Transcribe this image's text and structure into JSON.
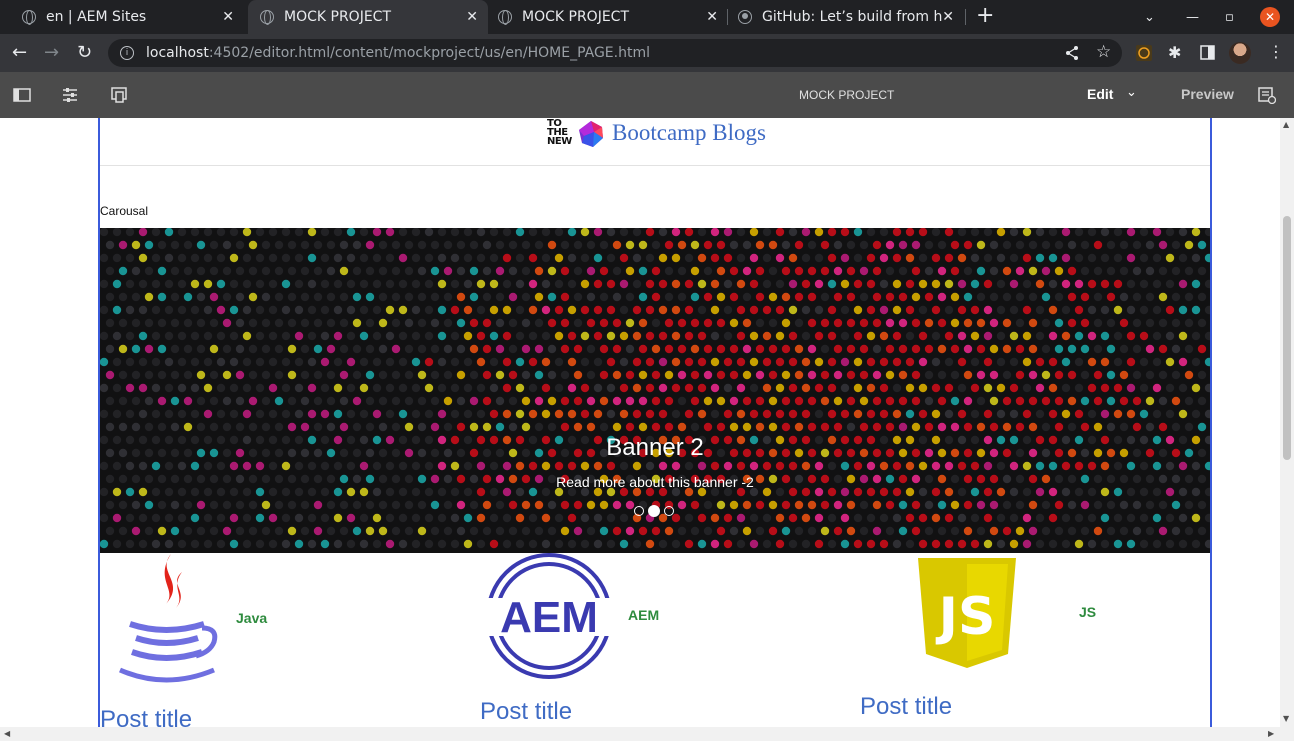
{
  "browser": {
    "tabs": [
      {
        "label": "en | AEM Sites"
      },
      {
        "label": "MOCK PROJECT"
      },
      {
        "label": "MOCK PROJECT"
      },
      {
        "label": "GitHub: Let’s build from h"
      }
    ],
    "url_host": "localhost",
    "url_rest": ":4502/editor.html/content/mockproject/us/en/HOME_PAGE.html"
  },
  "editor": {
    "page_title": "MOCK PROJECT",
    "mode_label": "Edit",
    "preview_label": "Preview"
  },
  "site": {
    "logo_text": [
      "TO",
      "THE",
      "NEW"
    ],
    "title": "Bootcamp Blogs",
    "carousel_label": "Carousal",
    "banner": {
      "title": "Banner 2",
      "subtitle": "Read more about this banner -2",
      "slide_count": 3,
      "active_slide": 2
    },
    "cards": [
      {
        "label": "Java",
        "icon": "java-logo-icon",
        "post_title": "Post title"
      },
      {
        "label": "AEM",
        "icon": "aem-logo-icon",
        "post_title": "Post title"
      },
      {
        "label": "JS",
        "icon": "js-logo-icon",
        "post_title": "Post title"
      }
    ]
  },
  "colors": {
    "accent_blue": "#3f6bc4",
    "label_green": "#2e8b3e",
    "frame_blue": "#3b5bdb",
    "aem_bar": "#4b4b4b"
  }
}
